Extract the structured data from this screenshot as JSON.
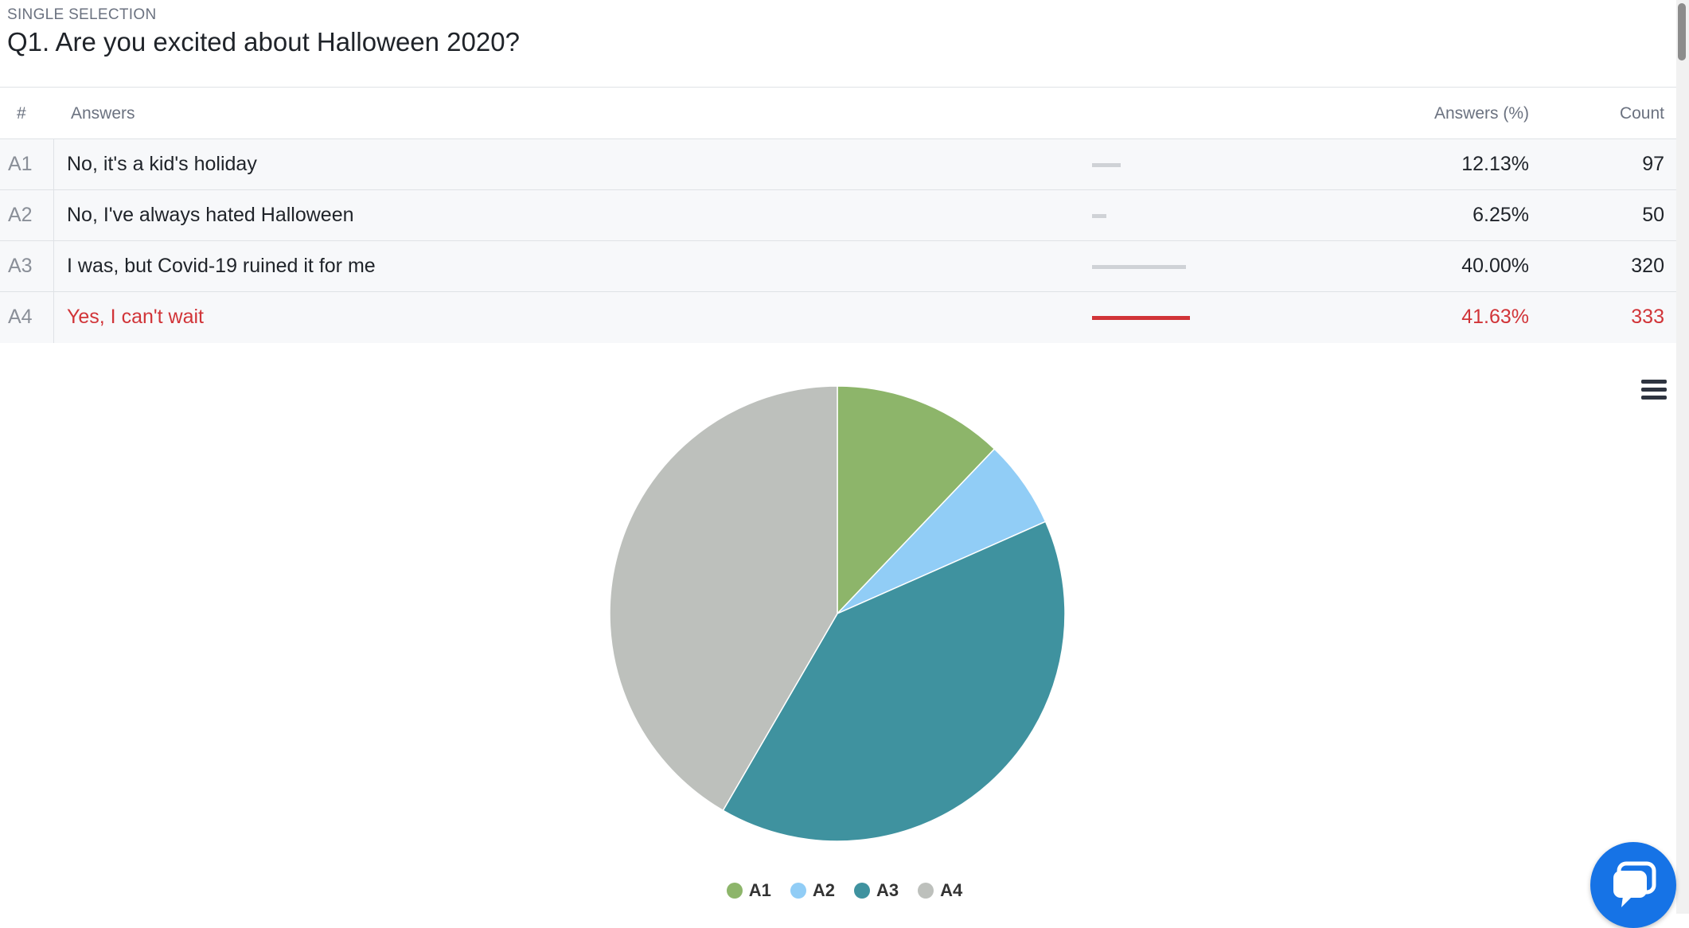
{
  "question": {
    "type_label": "SINGLE SELECTION",
    "title": "Q1. Are you excited about Halloween 2020?"
  },
  "table": {
    "headers": {
      "index": "#",
      "answers": "Answers",
      "percent": "Answers (%)",
      "count": "Count"
    },
    "rows": [
      {
        "id": "A1",
        "answer": "No, it's a kid's holiday",
        "percent": "12.13%",
        "count": "97",
        "share": 0.1213,
        "highlighted": false
      },
      {
        "id": "A2",
        "answer": "No, I've always hated Halloween",
        "percent": "6.25%",
        "count": "50",
        "share": 0.0625,
        "highlighted": false
      },
      {
        "id": "A3",
        "answer": "I was, but Covid-19 ruined it for me",
        "percent": "40.00%",
        "count": "320",
        "share": 0.4,
        "highlighted": false
      },
      {
        "id": "A4",
        "answer": "Yes, I can't wait",
        "percent": "41.63%",
        "count": "333",
        "share": 0.4163,
        "highlighted": true
      }
    ],
    "colors": {
      "bar": "#cfd2d6",
      "highlight": "#d13438"
    }
  },
  "chart_data": {
    "type": "pie",
    "categories": [
      "A1",
      "A2",
      "A3",
      "A4"
    ],
    "values": [
      97,
      50,
      320,
      333
    ],
    "colors": [
      "#8db56a",
      "#91cdf6",
      "#3f929f",
      "#bdc0bc"
    ],
    "legend_position": "bottom-center"
  },
  "icons": {
    "chart_menu": "hamburger-menu-icon",
    "chat": "chat-bubble-icon"
  }
}
